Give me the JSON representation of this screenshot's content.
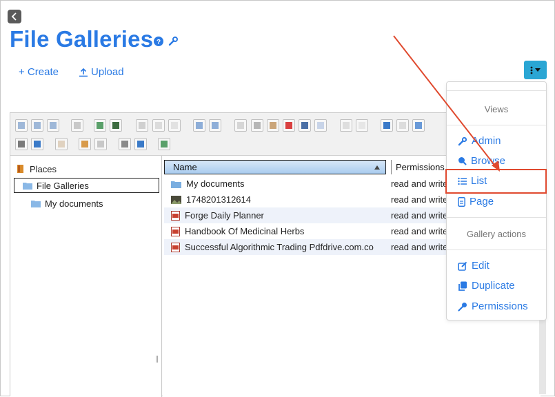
{
  "page": {
    "title": "File Galleries"
  },
  "actions": {
    "create_label": "+ Create",
    "upload_label": "Upload"
  },
  "tree": {
    "items": [
      {
        "label": "Places"
      },
      {
        "label": "File Galleries"
      },
      {
        "label": "My documents"
      }
    ]
  },
  "list": {
    "columns": {
      "name": "Name",
      "permissions": "Permissions"
    },
    "rows": [
      {
        "name": "My documents",
        "permissions": "read and write",
        "icon": "folder-icon"
      },
      {
        "name": "1748201312614",
        "permissions": "read and write",
        "icon": "image-icon"
      },
      {
        "name": "Forge Daily Planner",
        "permissions": "read and write",
        "icon": "pdf-icon"
      },
      {
        "name": "Handbook Of Medicinal Herbs",
        "permissions": "read and write",
        "icon": "pdf-icon"
      },
      {
        "name": "Successful Algorithmic Trading Pdfdrive.com.co",
        "permissions": "read and write",
        "icon": "pdf-icon"
      }
    ]
  },
  "dropdown": {
    "views_header": "Views",
    "views": [
      {
        "label": "Admin",
        "icon": "wrench-icon"
      },
      {
        "label": "Browse",
        "icon": "search-icon"
      },
      {
        "label": "List",
        "icon": "list-icon"
      },
      {
        "label": "Page",
        "icon": "page-icon"
      }
    ],
    "gallery_header": "Gallery actions",
    "gallery_actions": [
      {
        "label": "Edit",
        "icon": "edit-icon"
      },
      {
        "label": "Duplicate",
        "icon": "duplicate-icon"
      },
      {
        "label": "Permissions",
        "icon": "key-icon"
      }
    ]
  },
  "colors": {
    "accent": "#2a7ae4",
    "kebab_button": "#2aa6d4",
    "annotation": "#e04a2f"
  }
}
